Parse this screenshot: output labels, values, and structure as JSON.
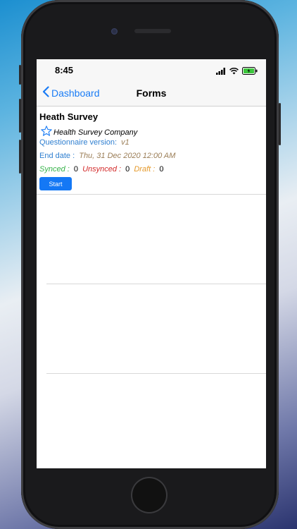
{
  "status_bar": {
    "time": "8:45"
  },
  "nav": {
    "back_label": "Dashboard",
    "title": "Forms"
  },
  "form": {
    "title": "Heath Survey",
    "company": "Health Survey Company",
    "version_label": "Questionnaire version:",
    "version_value": "v1",
    "end_date_label": "End date :",
    "end_date_value": "Thu, 31 Dec 2020 12:00 AM",
    "synced_label": "Synced :",
    "synced_count": "0",
    "unsynced_label": "Unsynced :",
    "unsynced_count": "0",
    "draft_label": "Draft :",
    "draft_count": "0",
    "start_label": "Start"
  },
  "colors": {
    "accent": "#1a7cf5",
    "synced": "#37b34a",
    "unsynced": "#d32a2a",
    "draft": "#e59a2c",
    "value_text": "#9b7e57"
  },
  "icons": [
    "signal-icon",
    "wifi-icon",
    "battery-icon",
    "chevron-left-icon",
    "star-icon"
  ]
}
